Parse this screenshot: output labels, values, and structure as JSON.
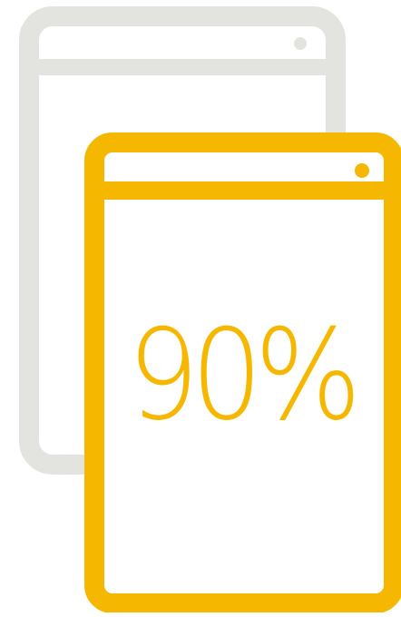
{
  "stat": {
    "value_text": "90%",
    "value": 90
  },
  "colors": {
    "accent": "#f5b700",
    "muted": "#e3e3e0",
    "background": "#ffffff"
  },
  "icons": {
    "back_device": "device-outline-icon",
    "front_device": "device-outline-icon"
  }
}
